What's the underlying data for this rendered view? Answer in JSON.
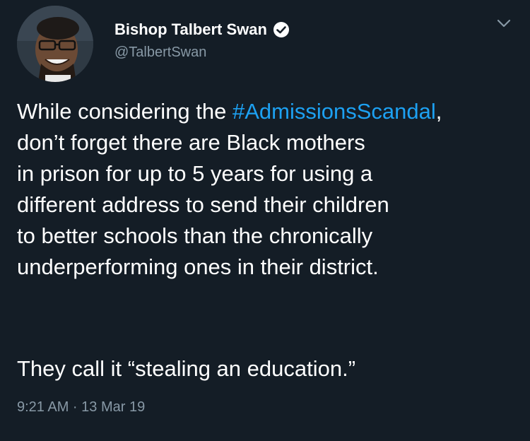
{
  "tweet": {
    "author": {
      "name": "Bishop Talbert Swan",
      "handle": "@TalbertSwan",
      "verified": true,
      "avatar_icon": "user-avatar"
    },
    "text_lines": [
      {
        "before": "While considering the ",
        "hashtag": "#AdmissionsScandal",
        "after": ","
      },
      {
        "text": "don’t forget there are Black mothers"
      },
      {
        "text": "in prison for up to 5 years for using a"
      },
      {
        "text": "different address to send their children"
      },
      {
        "text": "to better schools than the chronically"
      },
      {
        "text": "underperforming ones in their district."
      }
    ],
    "closing": "They call it “stealing an education.”",
    "timestamp": "9:21 AM · 13 Mar 19"
  },
  "colors": {
    "background": "#141d26",
    "text": "#ffffff",
    "secondary": "#8899a6",
    "link": "#1da1f2"
  },
  "icons": {
    "verified": "verified-badge-icon",
    "menu": "chevron-down-icon"
  }
}
